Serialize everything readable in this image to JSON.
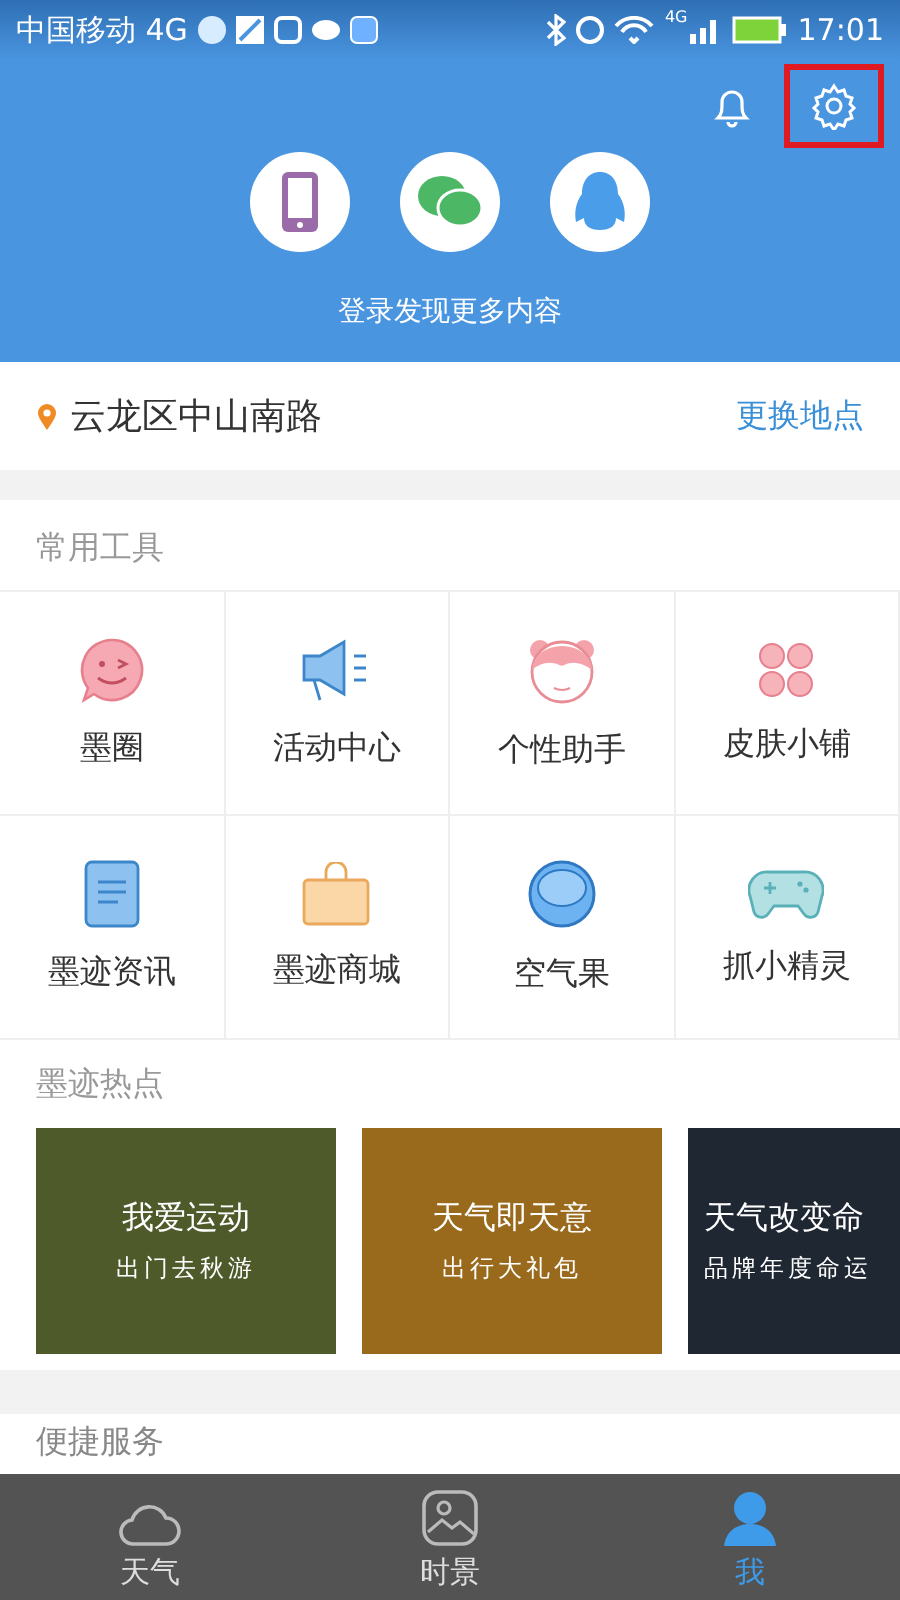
{
  "status_bar": {
    "carrier": "中国移动 4G",
    "network": "4G",
    "time": "17:01"
  },
  "header": {
    "login_prompt": "登录发现更多内容",
    "settings_highlighted": true
  },
  "location": {
    "address": "云龙区中山南路",
    "change_link": "更换地点"
  },
  "tools": {
    "title": "常用工具",
    "items": [
      {
        "label": "墨圈"
      },
      {
        "label": "活动中心"
      },
      {
        "label": "个性助手"
      },
      {
        "label": "皮肤小铺"
      },
      {
        "label": "墨迹资讯"
      },
      {
        "label": "墨迹商城"
      },
      {
        "label": "空气果"
      },
      {
        "label": "抓小精灵"
      }
    ]
  },
  "hot": {
    "title": "墨迹热点",
    "cards": [
      {
        "title": "我爱运动",
        "subtitle": "出门去秋游",
        "color": "#4e5a2a"
      },
      {
        "title": "天气即天意",
        "subtitle": "出行大礼包",
        "color": "#9a6a1c"
      },
      {
        "title": "天气改变命",
        "subtitle": "品牌年度命运",
        "color": "#1f2733"
      }
    ]
  },
  "services": {
    "title": "便捷服务"
  },
  "tab_bar": [
    {
      "label": "天气",
      "selected": false
    },
    {
      "label": "时景",
      "selected": false
    },
    {
      "label": "我",
      "selected": true
    }
  ]
}
